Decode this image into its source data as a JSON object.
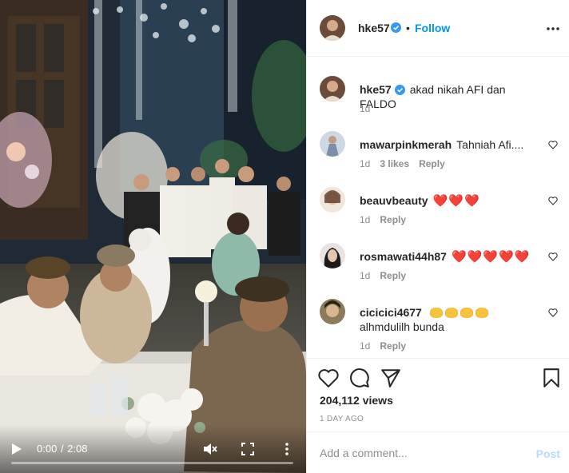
{
  "video": {
    "current_time": "0:00",
    "separator": "/",
    "duration": "2:08",
    "progress": 0
  },
  "header": {
    "username": "hke57",
    "verified": true,
    "follow_label": "Follow"
  },
  "caption": {
    "username": "hke57",
    "text": "akad nikah AFI dan FALDO",
    "time": "1d"
  },
  "comments": [
    {
      "username": "mawarpinkmerah",
      "text": "Tahniah Afi....",
      "time": "1d",
      "likes": "3 likes",
      "reply_label": "Reply"
    },
    {
      "username": "beauvbeauty",
      "text": "❤️❤️❤️",
      "time": "1d",
      "reply_label": "Reply"
    },
    {
      "username": "rosmawati44h87",
      "text": "❤️❤️❤️❤️❤️",
      "time": "1d",
      "reply_label": "Reply"
    },
    {
      "username": "cicicici4677",
      "emoji_count": 4,
      "text": "alhmdulilh bunda",
      "time": "1d",
      "reply_label": "Reply"
    }
  ],
  "stats": {
    "views": "204,112 views",
    "date": "1 DAY AGO"
  },
  "comment_box": {
    "placeholder": "Add a comment...",
    "post_label": "Post"
  },
  "colors": {
    "accent": "#0095f6",
    "verified": "#3897f0",
    "heart": "#ed4956",
    "muted": "#8e8e8e",
    "post_disabled": "#b3dbff"
  }
}
